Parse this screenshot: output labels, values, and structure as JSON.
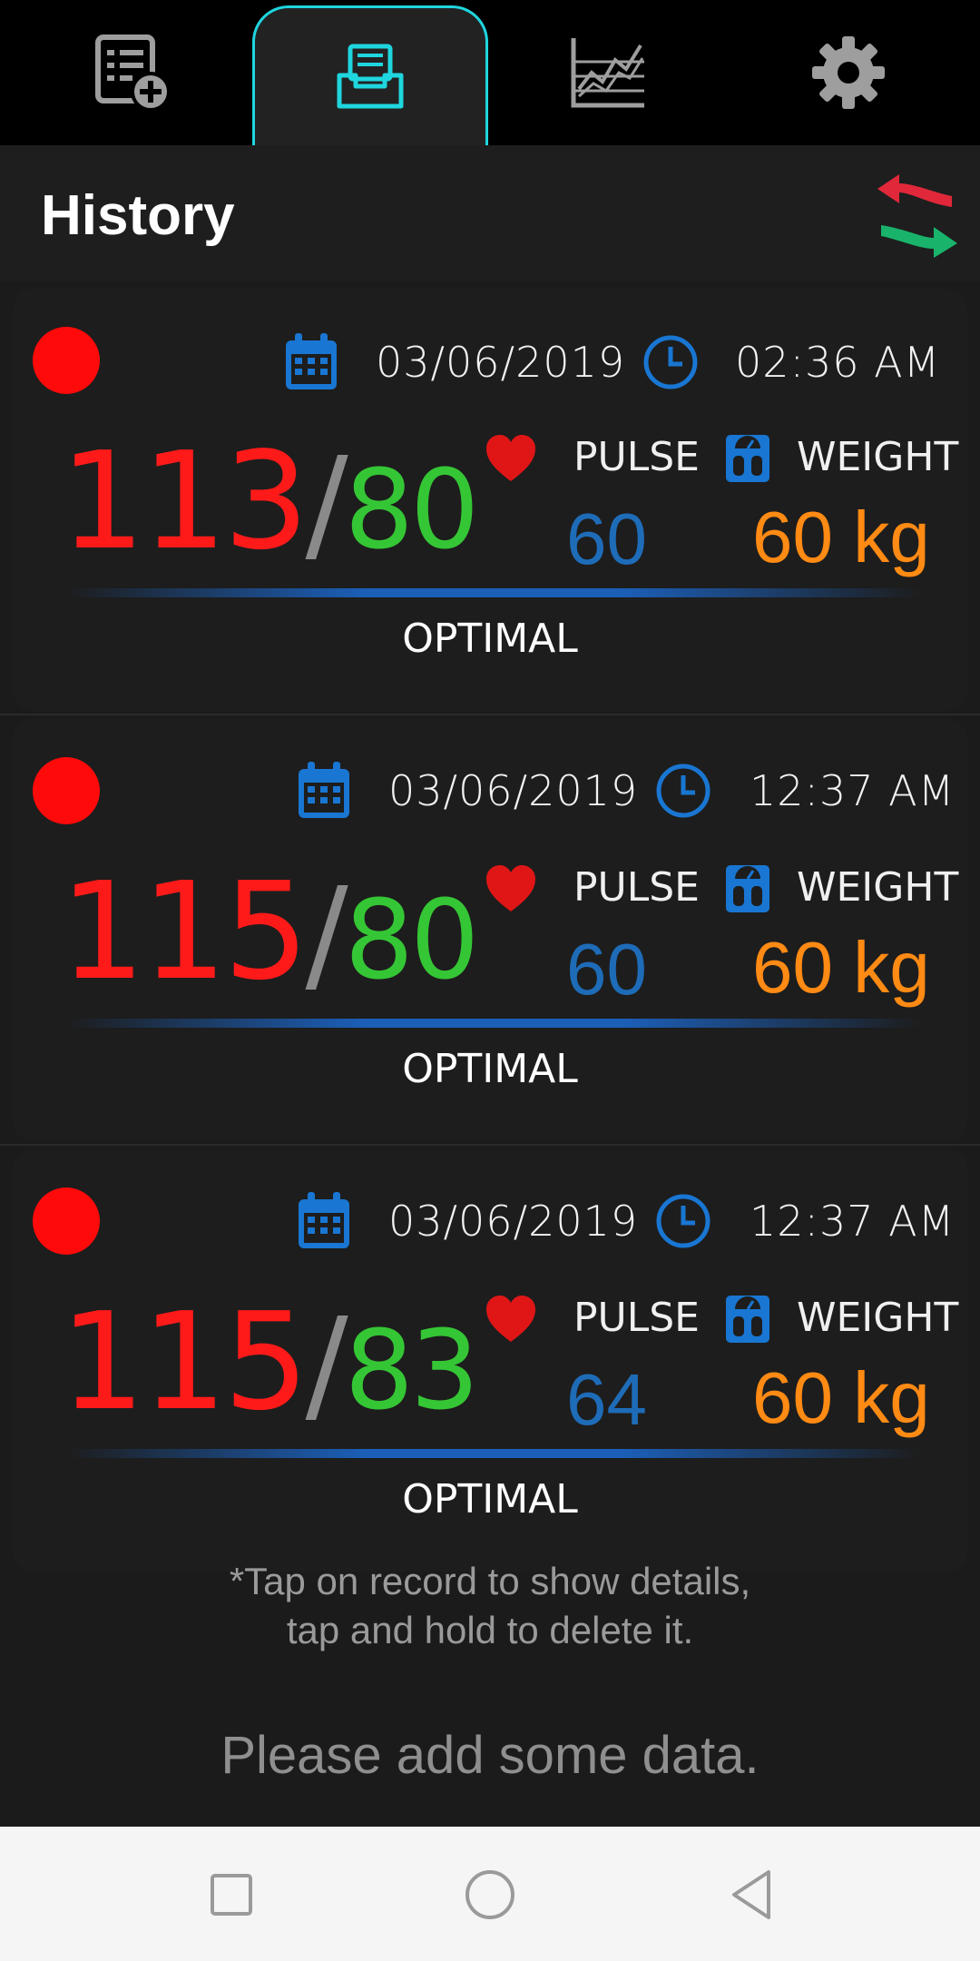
{
  "tabs": [
    {
      "name": "add-record-icon",
      "active": false
    },
    {
      "name": "history-inbox-icon",
      "active": true
    },
    {
      "name": "chart-icon",
      "active": false
    },
    {
      "name": "settings-gear-icon",
      "active": false
    }
  ],
  "header": {
    "title": "History",
    "action_icon": "swap-arrows-icon"
  },
  "records": [
    {
      "date": "03/06/2019",
      "time": "02:36  AM",
      "systolic": "113",
      "separator": "/",
      "diastolic": "80",
      "pulse_label": "PULSE",
      "pulse": "60",
      "weight_label": "WEIGHT",
      "weight": "60 kg",
      "category": "OPTIMAL"
    },
    {
      "date": "03/06/2019",
      "time": "12:37  AM",
      "systolic": "115",
      "separator": "/",
      "diastolic": "80",
      "pulse_label": "PULSE",
      "pulse": "60",
      "weight_label": "WEIGHT",
      "weight": "60 kg",
      "category": "OPTIMAL"
    },
    {
      "date": "03/06/2019",
      "time": "12:37  AM",
      "systolic": "115",
      "separator": "/",
      "diastolic": "83",
      "pulse_label": "PULSE",
      "pulse": "64",
      "weight_label": "WEIGHT",
      "weight": "60 kg",
      "category": "OPTIMAL"
    }
  ],
  "hint": {
    "line1": "*Tap on record to show details,",
    "line2": "tap and hold to delete it."
  },
  "empty_message": "Please add some data.",
  "colors": {
    "systolic": "#ff1a1a",
    "diastolic": "#35c635",
    "pulse": "#1e6cb8",
    "weight": "#ff8a14",
    "status_dot": "#ff0a0a",
    "tab_active_border": "#1fd6de",
    "icon_blue": "#1976d2"
  },
  "nav": [
    "recent-apps-icon",
    "home-icon",
    "back-icon"
  ]
}
